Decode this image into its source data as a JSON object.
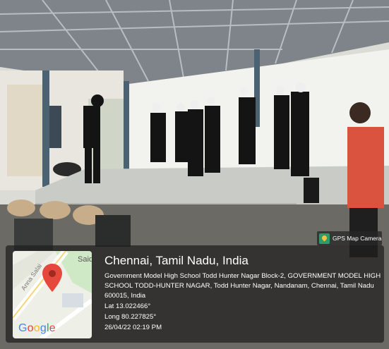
{
  "photo": {
    "description_colors": {
      "roof": "#8a8f94",
      "stage": "#cdd0cf",
      "wall": "#f4f4f2",
      "performer_clothes": "#151515",
      "red_shirt": "#d9533f"
    }
  },
  "badge": {
    "icon": "gps-map-camera-icon",
    "label": "GPS Map Camera"
  },
  "map": {
    "icon": "map-pin-icon",
    "street_label": "Saidape",
    "road_label": "Anna Salai",
    "brand": [
      "G",
      "o",
      "o",
      "g",
      "l",
      "e"
    ]
  },
  "location": {
    "title": "Chennai, Tamil Nadu, India",
    "address_line1": "Government Model High School Todd Hunter Nagar Block-2, GOVERNMENT MODEL HIGH",
    "address_line2": "SCHOOL TODD-HUNTER NAGAR, Todd Hunter Nagar, Nandanam, Chennai, Tamil Nadu",
    "address_line3": "600015, India",
    "lat": "Lat 13.022466°",
    "long": "Long 80.227825°",
    "datetime": "26/04/22 02:19 PM"
  }
}
